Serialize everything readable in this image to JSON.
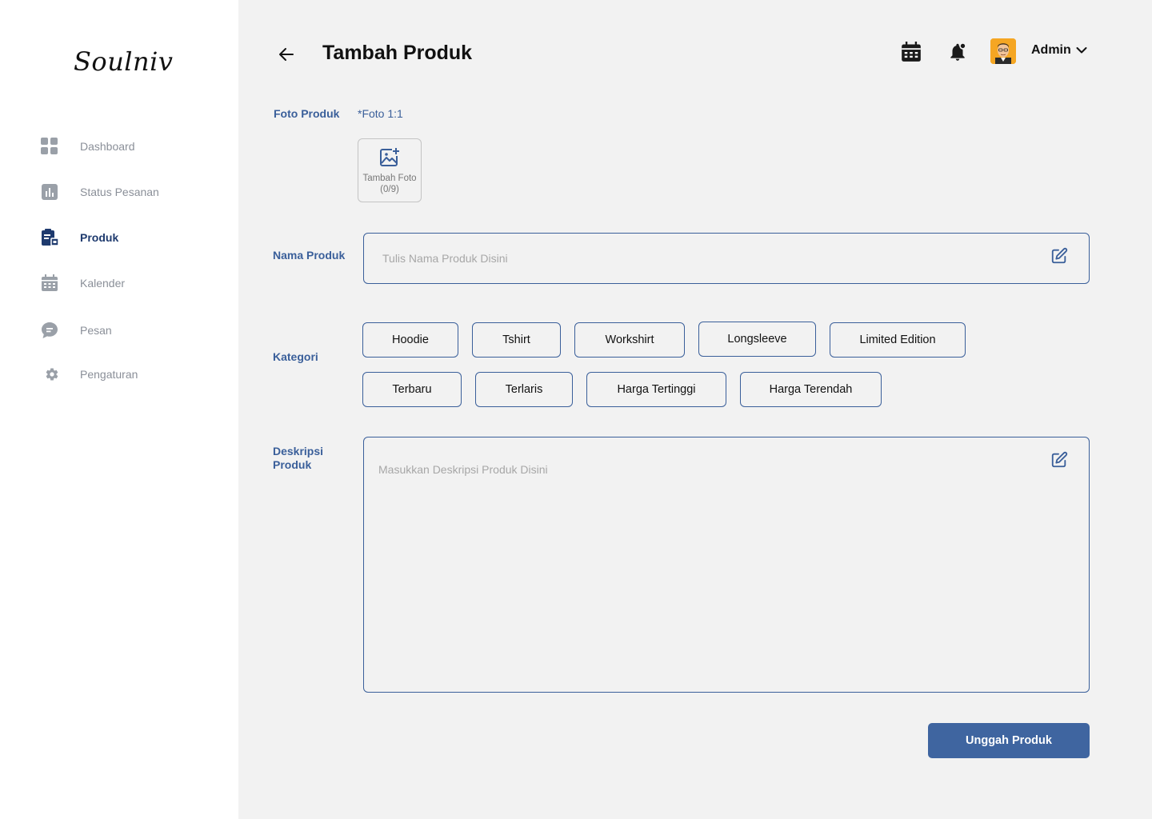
{
  "app": {
    "logo_text": "Soulniv"
  },
  "sidebar": {
    "items": [
      {
        "label": "Dashboard",
        "icon": "dashboard-grid-icon",
        "active": false
      },
      {
        "label": "Status Pesanan",
        "icon": "bar-chart-icon",
        "active": false
      },
      {
        "label": "Produk",
        "icon": "clipboard-product-icon",
        "active": true
      },
      {
        "label": "Kalender",
        "icon": "calendar-icon",
        "active": false
      },
      {
        "label": "Pesan",
        "icon": "chat-bubble-icon",
        "active": false
      },
      {
        "label": "Pengaturan",
        "icon": "gear-icon",
        "active": false
      }
    ]
  },
  "header": {
    "title": "Tambah Produk",
    "back_icon": "arrow-left-icon",
    "calendar_icon": "calendar-icon",
    "notification_icon": "bell-icon",
    "user_name": "Admin"
  },
  "form": {
    "photo": {
      "label": "Foto Produk",
      "hint": "*Foto 1:1",
      "add_label": "Tambah Foto (0/9)"
    },
    "name": {
      "label": "Nama Produk",
      "placeholder": "Tulis Nama Produk Disini",
      "value": ""
    },
    "category": {
      "label": "Kategori",
      "options": [
        "Hoodie",
        "Tshirt",
        "Workshirt",
        "Longsleeve",
        "Limited Edition",
        "Terbaru",
        "Terlaris",
        "Harga Tertinggi",
        "Harga Terendah"
      ]
    },
    "description": {
      "label": "Deskripsi Produk",
      "placeholder": "Masukkan Deskripsi Produk Disini",
      "value": ""
    },
    "submit_label": "Unggah Produk"
  },
  "colors": {
    "accent": "#3f65a0",
    "label": "#3a5f9a",
    "active_nav": "#1e3a6e",
    "inactive_nav": "#8a8f98",
    "background": "#f2f2f2"
  }
}
